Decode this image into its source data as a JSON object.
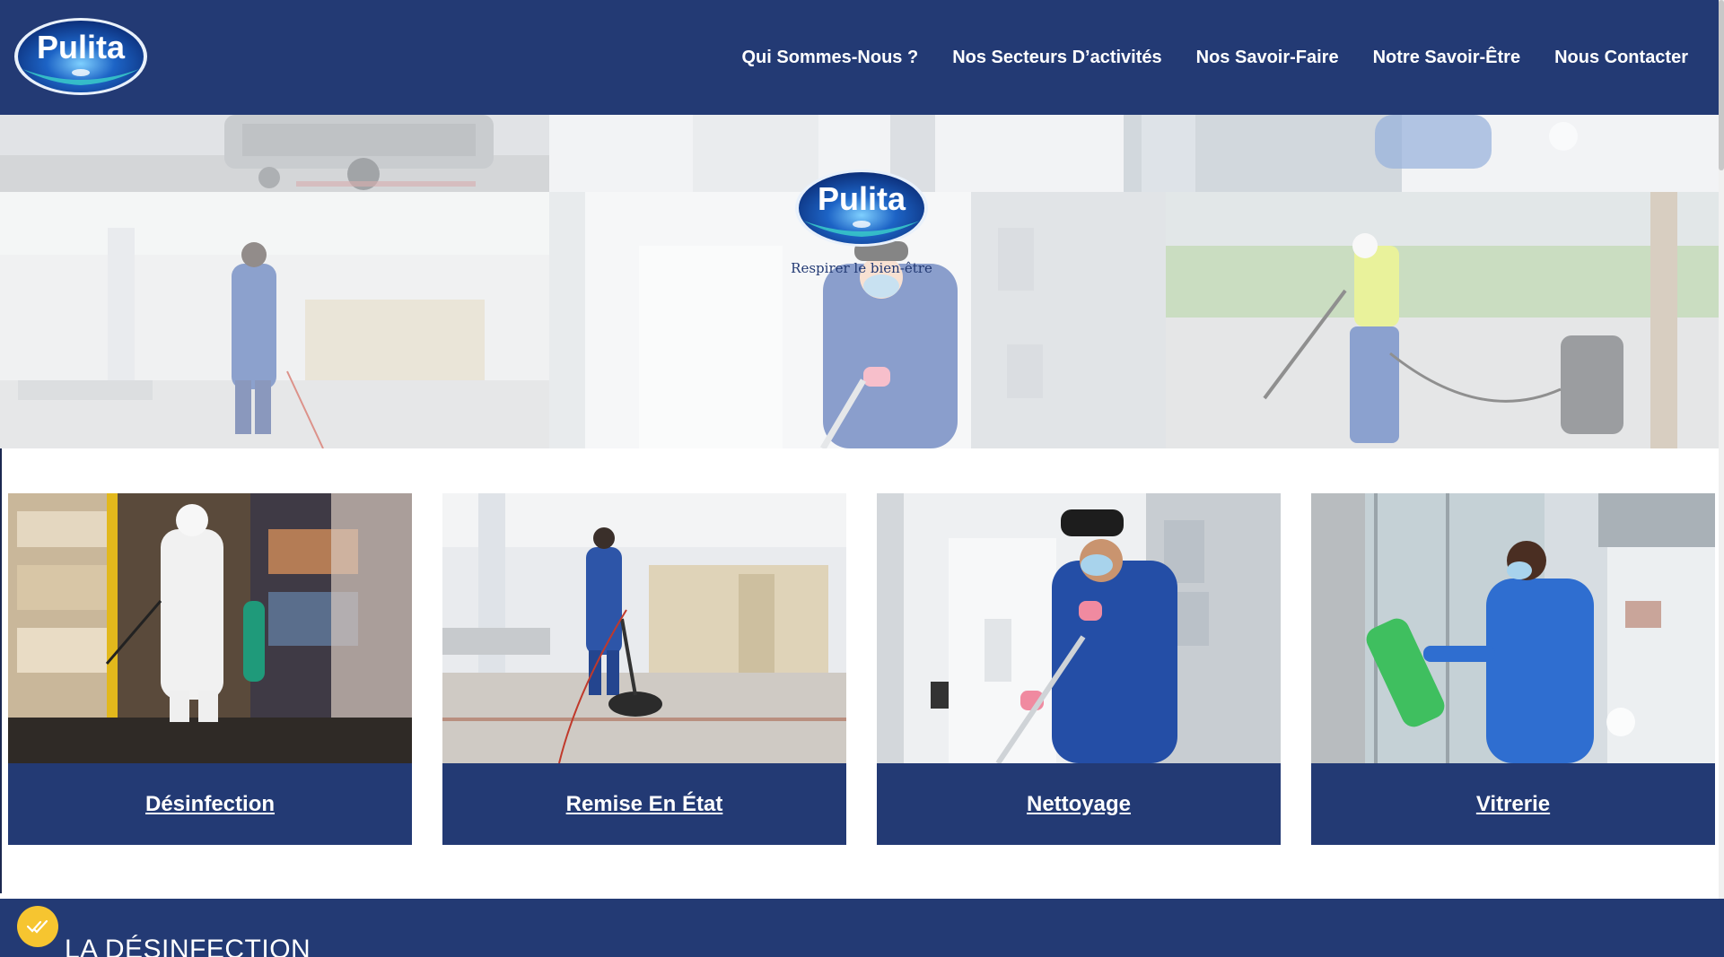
{
  "brand": {
    "logo_text": "Pulita",
    "tagline": "Respirer le bien-être"
  },
  "nav": {
    "items": [
      "Qui Sommes-Nous ?",
      "Nos Secteurs D’activités",
      "Nos Savoir-Faire",
      "Notre Savoir-Être",
      "Nous Contacter"
    ]
  },
  "services": [
    {
      "label": "Désinfection",
      "image": "worker-in-protective-suit-spraying-warehouse"
    },
    {
      "label": "Remise En État",
      "image": "worker-polishing-floor-with-machine"
    },
    {
      "label": "Nettoyage",
      "image": "worker-mopping-corridor"
    },
    {
      "label": "Vitrerie",
      "image": "worker-cleaning-window"
    }
  ],
  "section": {
    "title": "LA DÉSINFECTION",
    "badge_icon": "check-marks-icon"
  },
  "colors": {
    "primary": "#233a74",
    "accent": "#f6c530",
    "white": "#ffffff"
  }
}
